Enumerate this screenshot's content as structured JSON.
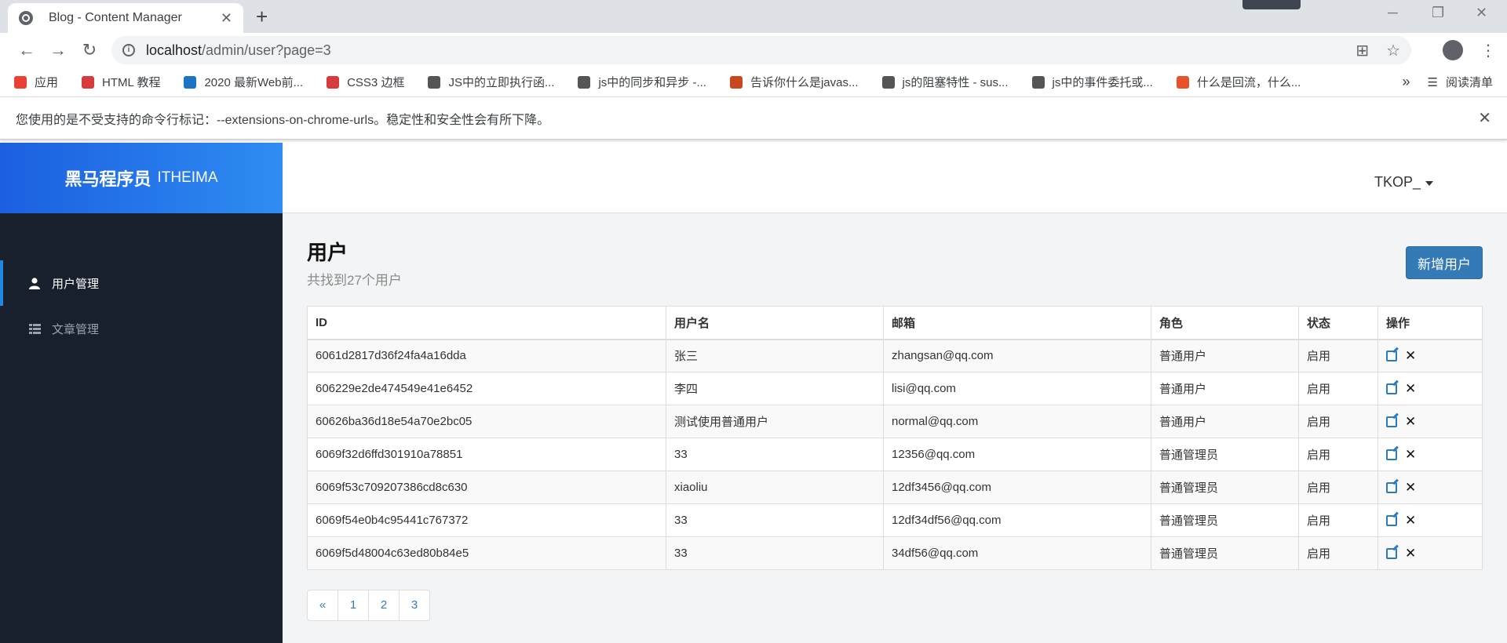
{
  "browser": {
    "tab_title": "Blog - Content Manager",
    "url_host": "localhost",
    "url_path": "/admin/user?page=3",
    "bookmarks": [
      {
        "label": "应用",
        "color": "#e94235"
      },
      {
        "label": "HTML 教程",
        "color": "#d83b3b"
      },
      {
        "label": "2020 最新Web前...",
        "color": "#1c74c4"
      },
      {
        "label": "CSS3 边框",
        "color": "#d83b3b"
      },
      {
        "label": "JS中的立即执行函...",
        "color": "#555555"
      },
      {
        "label": "js中的同步和异步 -...",
        "color": "#555555"
      },
      {
        "label": "告诉你什么是javas...",
        "color": "#c8471d"
      },
      {
        "label": "js的阻塞特性 - sus...",
        "color": "#555555"
      },
      {
        "label": "js中的事件委托或...",
        "color": "#555555"
      },
      {
        "label": "什么是回流，什么...",
        "color": "#e8512a"
      }
    ],
    "more_bookmarks": "»",
    "reading_list": "阅读清单",
    "infobar_text": "您使用的是不受支持的命令行标记：--extensions-on-chrome-urls。稳定性和安全性会有所下降。"
  },
  "sidebar": {
    "brand_cn": "黑马程序员",
    "brand_en": "ITHEIMA",
    "items": [
      {
        "label": "用户管理",
        "icon": "user-icon",
        "active": true
      },
      {
        "label": "文章管理",
        "icon": "list-icon",
        "active": false
      }
    ]
  },
  "header": {
    "username": "TKOP_"
  },
  "page": {
    "title": "用户",
    "subtitle": "共找到27个用户",
    "add_button": "新增用户"
  },
  "table": {
    "columns": [
      "ID",
      "用户名",
      "邮箱",
      "角色",
      "状态",
      "操作"
    ],
    "rows": [
      [
        "6061d2817d36f24fa4a16dda",
        "张三",
        "zhangsan@qq.com",
        "普通用户",
        "启用"
      ],
      [
        "606229e2de474549e41e6452",
        "李四",
        "lisi@qq.com",
        "普通用户",
        "启用"
      ],
      [
        "60626ba36d18e54a70e2bc05",
        "测试使用普通用户",
        "normal@qq.com",
        "普通用户",
        "启用"
      ],
      [
        "6069f32d6ffd301910a78851",
        "33",
        "12356@qq.com",
        "普通管理员",
        "启用"
      ],
      [
        "6069f53c709207386cd8c630",
        "xiaoliu",
        "12df3456@qq.com",
        "普通管理员",
        "启用"
      ],
      [
        "6069f54e0b4c95441c767372",
        "33",
        "12df34df56@qq.com",
        "普通管理员",
        "启用"
      ],
      [
        "6069f5d48004c63ed80b84e5",
        "33",
        "34df56@qq.com",
        "普通管理员",
        "启用"
      ]
    ]
  },
  "pagination": [
    "«",
    "1",
    "2",
    "3"
  ]
}
